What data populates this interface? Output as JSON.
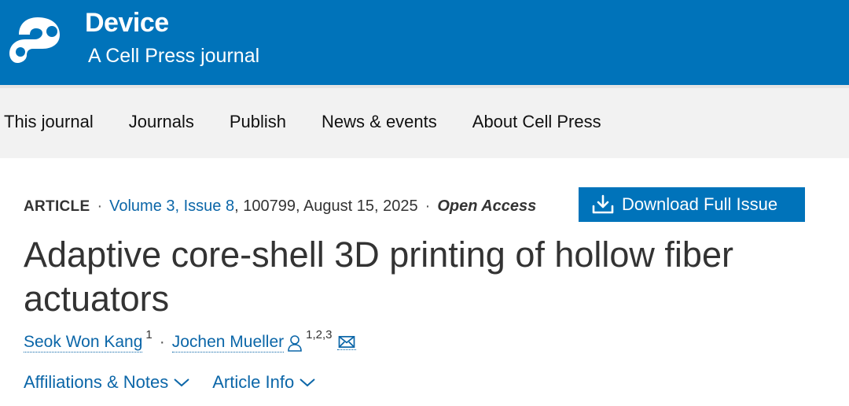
{
  "brand": {
    "title": "Device",
    "subtitle": "A Cell Press journal",
    "color": "#0073ba"
  },
  "nav": {
    "items": [
      "This journal",
      "Journals",
      "Publish",
      "News & events",
      "About Cell Press"
    ]
  },
  "article": {
    "type": "ARTICLE",
    "volume_issue": "Volume 3, Issue 8",
    "id_date": ", 100799, August 15, 2025",
    "access": "Open Access",
    "download_label": "Download Full Issue",
    "title": "Adaptive core-shell 3D printing of hollow fiber actuators",
    "authors": [
      {
        "name": "Seok Won Kang",
        "affil": "1"
      },
      {
        "name": "Jochen Mueller",
        "affil": "1,2,3"
      }
    ]
  },
  "tabs": {
    "affiliations": "Affiliations & Notes",
    "info": "Article Info"
  },
  "icons": [
    "logo-icon",
    "download-icon",
    "person-icon",
    "mail-icon",
    "chevron-down-icon"
  ],
  "colors": {
    "link": "#0b66a8",
    "button": "#0073ba",
    "nav_bg": "#f2f2f2"
  }
}
